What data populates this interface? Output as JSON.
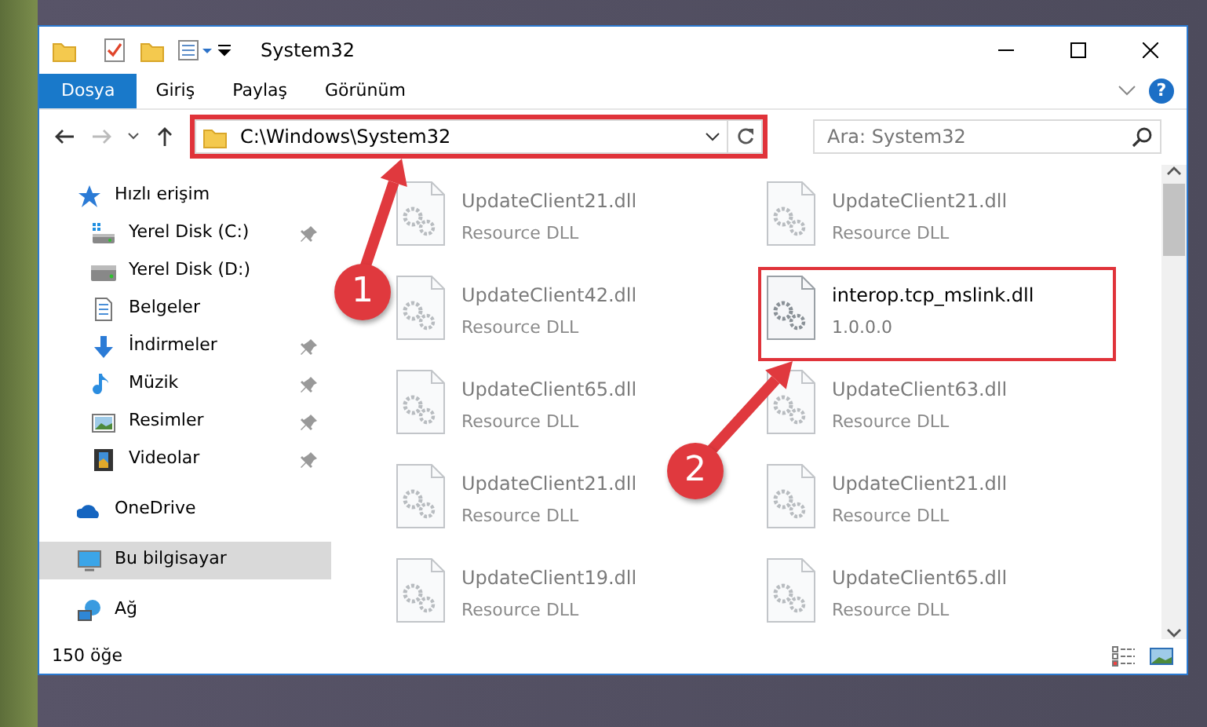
{
  "window": {
    "title": "System32"
  },
  "ribbon": {
    "tabs": [
      {
        "label": "Dosya",
        "selected": true
      },
      {
        "label": "Giriş",
        "selected": false
      },
      {
        "label": "Paylaş",
        "selected": false
      },
      {
        "label": "Görünüm",
        "selected": false
      }
    ],
    "help": "?"
  },
  "address": {
    "path": "C:\\Windows\\System32",
    "highlighted": true
  },
  "search": {
    "placeholder": "Ara: System32"
  },
  "sidebar": {
    "items": [
      {
        "label": "Hızlı erişim",
        "kind": "star",
        "selected": false,
        "children": [
          {
            "label": "Yerel Disk (C:)",
            "kind": "drive-c",
            "pinned": true,
            "selected": false
          },
          {
            "label": "Yerel Disk (D:)",
            "kind": "drive",
            "pinned": false,
            "selected": false
          },
          {
            "label": "Belgeler",
            "kind": "document",
            "pinned": false,
            "selected": false
          },
          {
            "label": "İndirmeler",
            "kind": "download",
            "pinned": true,
            "selected": false
          },
          {
            "label": "Müzik",
            "kind": "music",
            "pinned": true,
            "selected": false
          },
          {
            "label": "Resimler",
            "kind": "pictures",
            "pinned": true,
            "selected": false
          },
          {
            "label": "Videolar",
            "kind": "video",
            "pinned": true,
            "selected": false
          }
        ]
      },
      {
        "label": "OneDrive",
        "kind": "cloud",
        "selected": false
      },
      {
        "label": "Bu bilgisayar",
        "kind": "computer",
        "selected": true
      },
      {
        "label": "Ağ",
        "kind": "network",
        "selected": false
      }
    ]
  },
  "files": [
    {
      "name": "UpdateClient21.dll",
      "detail": "Resource DLL",
      "blurred": true,
      "highlighted": false
    },
    {
      "name": "UpdateClient21.dll",
      "detail": "Resource DLL",
      "blurred": true,
      "highlighted": false
    },
    {
      "name": "UpdateClient42.dll",
      "detail": "Resource DLL",
      "blurred": true,
      "highlighted": false
    },
    {
      "name": "interop.tcp_mslink.dll",
      "detail": "1.0.0.0",
      "blurred": false,
      "highlighted": true
    },
    {
      "name": "UpdateClient65.dll",
      "detail": "Resource DLL",
      "blurred": true,
      "highlighted": false
    },
    {
      "name": "UpdateClient63.dll",
      "detail": "Resource DLL",
      "blurred": true,
      "highlighted": false
    },
    {
      "name": "UpdateClient21.dll",
      "detail": "Resource DLL",
      "blurred": true,
      "highlighted": false
    },
    {
      "name": "UpdateClient21.dll",
      "detail": "Resource DLL",
      "blurred": true,
      "highlighted": false
    },
    {
      "name": "UpdateClient19.dll",
      "detail": "Resource DLL",
      "blurred": true,
      "highlighted": false
    },
    {
      "name": "UpdateClient65.dll",
      "detail": "Resource DLL",
      "blurred": true,
      "highlighted": false
    }
  ],
  "status_bar": {
    "count": "150 öğe"
  },
  "annotations": [
    {
      "label": "1"
    },
    {
      "label": "2"
    }
  ]
}
